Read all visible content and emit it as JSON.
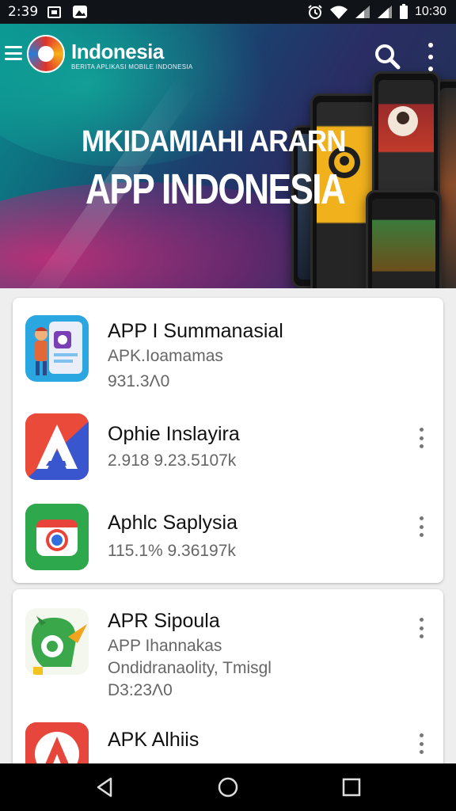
{
  "status_bar": {
    "time": "2:39",
    "clock": "10:30",
    "icons": [
      "notification-square-icon",
      "notification-photo-icon",
      "alarm-icon",
      "wifi-icon",
      "signal-icon",
      "signal-icon",
      "battery-icon"
    ]
  },
  "header": {
    "brand": "Indonesia",
    "brand_sub": "BERITA APLIKASI MOBILE INDONESIA",
    "headline_line1": "MKIDAMIAHI ARARN",
    "headline_line2": "APP INDONESIA",
    "icons": [
      "menu-icon",
      "logo",
      "search-icon",
      "more-vert-icon"
    ]
  },
  "apps": [
    {
      "title": "APP I Summanasial",
      "subtitle": "APK.Ioamamas",
      "meta": "931.3Ʌ0",
      "icon": "app-cartoon-icon"
    },
    {
      "title": "Ophie Inslayira",
      "meta": "2.918 9.23.5107k",
      "icon": "app-a-logo-icon"
    },
    {
      "title": "Aphlc Saplysia",
      "meta": "115.1% 9.36197k",
      "icon": "app-camera-icon"
    },
    {
      "title": "APR Sipoula",
      "subtitle": "APP Ihannakas",
      "description": "Ondidranaolity, Tmisgl",
      "meta": "D3:23Λ0",
      "icon": "app-bird-icon"
    },
    {
      "title": "APK Alhiis",
      "icon": "app-a-red-icon"
    }
  ],
  "colors": {
    "banner_teal": "#0a8f8f",
    "banner_navy": "#1c3e6e",
    "banner_magenta": "#d22878",
    "card_bg": "#ffffff",
    "page_bg": "#eeeeee"
  },
  "nav_bar": {
    "icons": [
      "back-icon",
      "home-icon",
      "recents-icon"
    ]
  }
}
